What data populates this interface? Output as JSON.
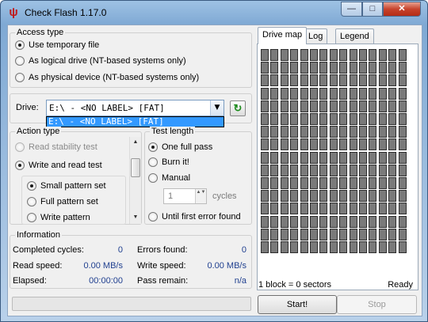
{
  "window": {
    "title": "Check Flash 1.17.0",
    "minimize": "—",
    "maximize": "□",
    "close": "✕"
  },
  "access": {
    "group": "Access type",
    "options": [
      "Use temporary file",
      "As logical drive (NT-based systems only)",
      "As physical device (NT-based systems only)"
    ],
    "selected": 0
  },
  "drive": {
    "label": "Drive:",
    "value": "E:\\ - <NO LABEL> [FAT]",
    "dropdown_item": "E:\\ - <NO LABEL> [FAT]",
    "arrow": "▼",
    "refresh": "↻"
  },
  "action": {
    "group": "Action type",
    "options": [
      "Read stability test",
      "Write and read test"
    ],
    "selected": 1,
    "sub_options": [
      "Small pattern set",
      "Full pattern set",
      "Write pattern"
    ],
    "sub_selected": 0,
    "scroll_up": "▲",
    "scroll_down": "▼"
  },
  "test": {
    "group": "Test length",
    "options": [
      "One full pass",
      "Burn it!",
      "Manual"
    ],
    "selected": 0,
    "spin_value": "1",
    "spin_arrows": "▲▼",
    "cycles_label": "cycles",
    "until_error": "Until first error found"
  },
  "info": {
    "group": "Information",
    "completed_label": "Completed cycles:",
    "completed_value": "0",
    "errors_label": "Errors found:",
    "errors_value": "0",
    "read_label": "Read speed:",
    "read_value": "0.00 MB/s",
    "write_label": "Write speed:",
    "write_value": "0.00 MB/s",
    "elapsed_label": "Elapsed:",
    "elapsed_value": "00:00:00",
    "remain_label": "Pass remain:",
    "remain_value": "n/a"
  },
  "tabs": [
    "Drive map",
    "Log",
    "Legend"
  ],
  "active_tab": 0,
  "map": {
    "block_text": "1 block = 0 sectors",
    "status": "Ready",
    "cell_color": "#7a7a7a"
  },
  "buttons": {
    "start": "Start!",
    "stop": "Stop"
  }
}
